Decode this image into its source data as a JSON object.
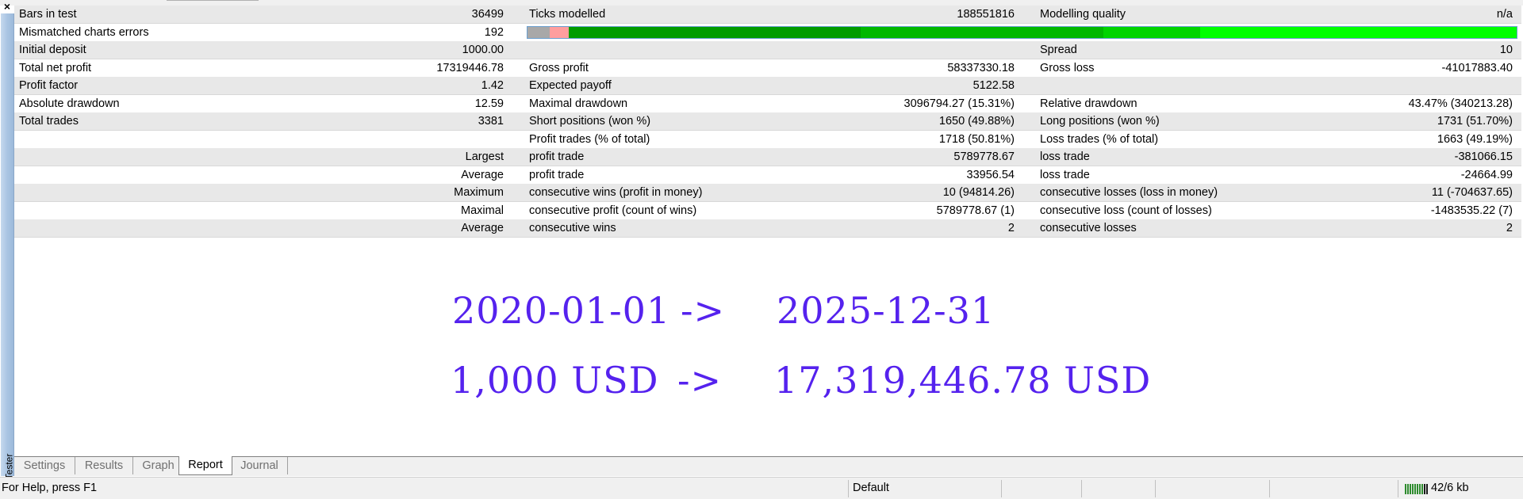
{
  "window": {
    "close_glyph": "×",
    "side_label": "Tester"
  },
  "report": {
    "rows": [
      {
        "shaded": true,
        "c1": "Bars in test",
        "c2": "36499",
        "c3": "Ticks modelled",
        "c4": "188551816",
        "c5": "Modelling quality",
        "c6": "n/a"
      },
      {
        "shaded": false,
        "c1": "Mismatched charts errors",
        "c2": "192",
        "c3": "",
        "c4": "",
        "c5": "",
        "c6": "",
        "quality_bar": true
      },
      {
        "shaded": true,
        "c1": "Initial deposit",
        "c2": "1000.00",
        "c3": "",
        "c4": "",
        "c5": "Spread",
        "c6": "10"
      },
      {
        "shaded": false,
        "c1": "Total net profit",
        "c2": "17319446.78",
        "c3": "Gross profit",
        "c4": "58337330.18",
        "c5": "Gross loss",
        "c6": "-41017883.40"
      },
      {
        "shaded": true,
        "c1": "Profit factor",
        "c2": "1.42",
        "c3": "Expected payoff",
        "c4": "5122.58",
        "c5": "",
        "c6": ""
      },
      {
        "shaded": false,
        "c1": "Absolute drawdown",
        "c2": "12.59",
        "c3": "Maximal drawdown",
        "c4": "3096794.27 (15.31%)",
        "c5": "Relative drawdown",
        "c6": "43.47% (340213.28)"
      },
      {
        "shaded": true,
        "c1": "Total trades",
        "c2": "3381",
        "c3": "Short positions (won %)",
        "c4": "1650 (49.88%)",
        "c5": "Long positions (won %)",
        "c6": "1731 (51.70%)"
      },
      {
        "shaded": false,
        "c1": "",
        "c2": "",
        "c3": "Profit trades (% of total)",
        "c4": "1718 (50.81%)",
        "c5": "Loss trades (% of total)",
        "c6": "1663 (49.19%)"
      },
      {
        "shaded": true,
        "c1": "",
        "c2": "Largest",
        "c3": "profit trade",
        "c4": "5789778.67",
        "c5": "loss trade",
        "c6": "-381066.15"
      },
      {
        "shaded": false,
        "c1": "",
        "c2": "Average",
        "c3": "profit trade",
        "c4": "33956.54",
        "c5": "loss trade",
        "c6": "-24664.99"
      },
      {
        "shaded": true,
        "c1": "",
        "c2": "Maximum",
        "c3": "consecutive wins (profit in money)",
        "c4": "10 (94814.26)",
        "c5": "consecutive losses (loss in money)",
        "c6": "11 (-704637.65)"
      },
      {
        "shaded": false,
        "c1": "",
        "c2": "Maximal",
        "c3": "consecutive profit (count of wins)",
        "c4": "5789778.67 (1)",
        "c5": "consecutive loss (count of losses)",
        "c6": "-1483535.22 (7)"
      },
      {
        "shaded": true,
        "c1": "",
        "c2": "Average",
        "c3": "consecutive wins",
        "c4": "2",
        "c5": "consecutive losses",
        "c6": "2"
      }
    ],
    "quality_segments": [
      {
        "color": "#a8a8a8",
        "fraction": 0.0225
      },
      {
        "color": "#ff9e9e",
        "fraction": 0.019
      },
      {
        "color": "#009c00",
        "fraction": 0.2955
      },
      {
        "color": "#00b800",
        "fraction": 0.245
      },
      {
        "color": "#00d400",
        "fraction": 0.098
      },
      {
        "color": "#00ff00",
        "fraction": 0.32
      }
    ]
  },
  "overlay": {
    "line1": {
      "from": "2020-01-01",
      "arrow": "->",
      "to": "2025-12-31"
    },
    "line2": {
      "from": "1,000 USD",
      "arrow": "->",
      "to": "17,319,446.78 USD"
    },
    "color": "#5522ee"
  },
  "tabs": [
    {
      "label": "Settings",
      "active": false
    },
    {
      "label": "Results",
      "active": false
    },
    {
      "label": "Graph",
      "active": false
    },
    {
      "label": "Report",
      "active": true
    },
    {
      "label": "Journal",
      "active": false
    }
  ],
  "statusbar": {
    "help": "For Help, press F1",
    "profile": "Default",
    "traffic": "42/6 kb",
    "meter_fill": 0.75
  }
}
